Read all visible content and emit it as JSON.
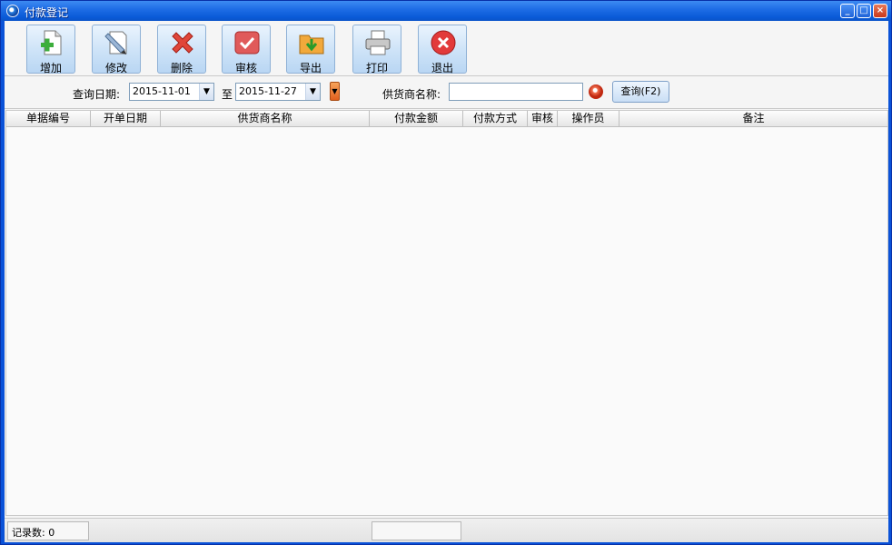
{
  "window": {
    "title": "付款登记"
  },
  "toolbar": {
    "buttons": [
      {
        "label": "增加",
        "icon": "add-document-icon"
      },
      {
        "label": "修改",
        "icon": "edit-pen-icon"
      },
      {
        "label": "删除",
        "icon": "delete-x-icon"
      },
      {
        "label": "审核",
        "icon": "approve-check-icon"
      },
      {
        "label": "导出",
        "icon": "export-folder-icon"
      },
      {
        "label": "打印",
        "icon": "printer-icon"
      },
      {
        "label": "退出",
        "icon": "exit-icon"
      }
    ]
  },
  "query": {
    "date_label": "查询日期:",
    "date_from": "2015-11-01",
    "to_label": "至",
    "date_to": "2015-11-27",
    "supplier_label": "供货商名称:",
    "supplier_value": "",
    "search_button": "查询(F2)"
  },
  "grid": {
    "columns": [
      "单据编号",
      "开单日期",
      "供货商名称",
      "付款金额",
      "付款方式",
      "审核",
      "操作员",
      "备注"
    ],
    "rows": []
  },
  "status": {
    "record_label": "记录数: 0"
  },
  "colors": {
    "accent": "#2a63d8",
    "toolbar_button": "#cfe4f8"
  }
}
